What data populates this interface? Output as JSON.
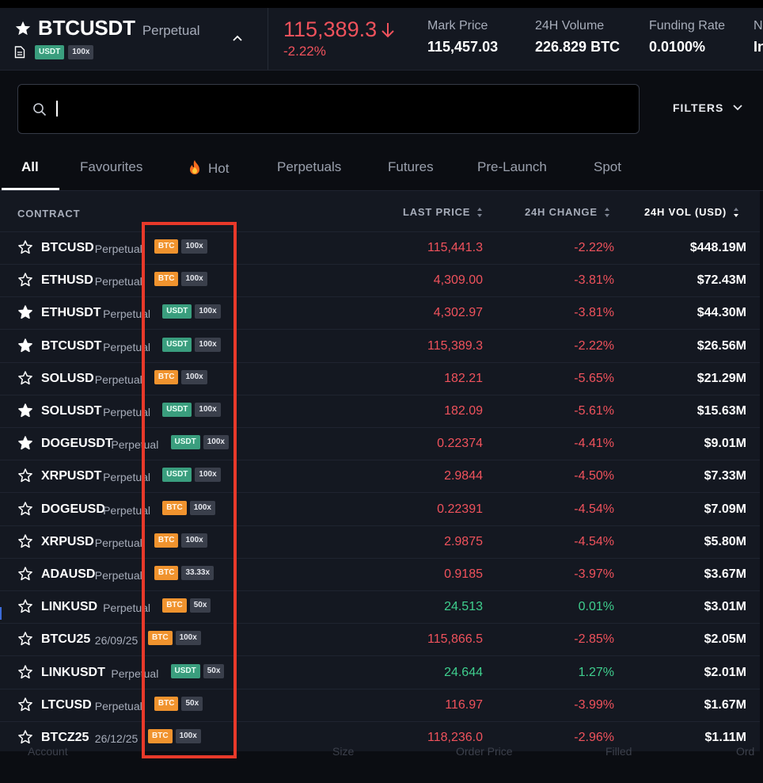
{
  "header": {
    "symbol": "BTCUSDT",
    "type": "Perpetual",
    "margin_tag": "USDT",
    "leverage_tag": "100x",
    "last_price": "115,389.3",
    "change": "-2.22%",
    "stats": [
      {
        "label": "Mark Price",
        "value": "115,457.03"
      },
      {
        "label": "24H Volume",
        "value": "226.829 BTC"
      },
      {
        "label": "Funding Rate",
        "value": "0.0100%"
      },
      {
        "label": "N",
        "value": "In"
      }
    ]
  },
  "search": {
    "placeholder": "",
    "value": ""
  },
  "filters_label": "FILTERS",
  "tabs": [
    "All",
    "Favourites",
    "Hot",
    "Perpetuals",
    "Futures",
    "Pre-Launch",
    "Spot"
  ],
  "table": {
    "headers": {
      "contract": "CONTRACT",
      "last_price": "LAST PRICE",
      "change": "24H CHANGE",
      "volume": "24H VOL (USD)"
    },
    "rows": [
      {
        "name": "BTCUSD",
        "type": "Perpetual",
        "margin": "BTC",
        "lev": "100x",
        "price": "115,441.3",
        "change": "-2.22%",
        "vol": "$448.19M"
      },
      {
        "name": "ETHUSD",
        "type": "Perpetual",
        "margin": "BTC",
        "lev": "100x",
        "price": "4,309.00",
        "change": "-3.81%",
        "vol": "$72.43M"
      },
      {
        "name": "ETHUSDT",
        "type": "Perpetual",
        "margin": "USDT",
        "lev": "100x",
        "price": "4,302.97",
        "change": "-3.81%",
        "vol": "$44.30M"
      },
      {
        "name": "BTCUSDT",
        "type": "Perpetual",
        "margin": "USDT",
        "lev": "100x",
        "price": "115,389.3",
        "change": "-2.22%",
        "vol": "$26.56M"
      },
      {
        "name": "SOLUSD",
        "type": "Perpetual",
        "margin": "BTC",
        "lev": "100x",
        "price": "182.21",
        "change": "-5.65%",
        "vol": "$21.29M"
      },
      {
        "name": "SOLUSDT",
        "type": "Perpetual",
        "margin": "USDT",
        "lev": "100x",
        "price": "182.09",
        "change": "-5.61%",
        "vol": "$15.63M"
      },
      {
        "name": "DOGEUSDT",
        "type": "Perpetual",
        "margin": "USDT",
        "lev": "100x",
        "price": "0.22374",
        "change": "-4.41%",
        "vol": "$9.01M"
      },
      {
        "name": "XRPUSDT",
        "type": "Perpetual",
        "margin": "USDT",
        "lev": "100x",
        "price": "2.9844",
        "change": "-4.50%",
        "vol": "$7.33M"
      },
      {
        "name": "DOGEUSD",
        "type": "Perpetual",
        "margin": "BTC",
        "lev": "100x",
        "price": "0.22391",
        "change": "-4.54%",
        "vol": "$7.09M"
      },
      {
        "name": "XRPUSD",
        "type": "Perpetual",
        "margin": "BTC",
        "lev": "100x",
        "price": "2.9875",
        "change": "-4.54%",
        "vol": "$5.80M"
      },
      {
        "name": "ADAUSD",
        "type": "Perpetual",
        "margin": "BTC",
        "lev": "33.33x",
        "price": "0.9185",
        "change": "-3.97%",
        "vol": "$3.67M"
      },
      {
        "name": "LINKUSD",
        "type": "Perpetual",
        "margin": "BTC",
        "lev": "50x",
        "price": "24.513",
        "change": "0.01%",
        "vol": "$3.01M"
      },
      {
        "name": "BTCU25",
        "type": "26/09/25",
        "margin": "BTC",
        "lev": "100x",
        "price": "115,866.5",
        "change": "-2.85%",
        "vol": "$2.05M"
      },
      {
        "name": "LINKUSDT",
        "type": "Perpetual",
        "margin": "USDT",
        "lev": "50x",
        "price": "24.644",
        "change": "1.27%",
        "vol": "$2.01M"
      },
      {
        "name": "LTCUSD",
        "type": "Perpetual",
        "margin": "BTC",
        "lev": "50x",
        "price": "116.97",
        "change": "-3.99%",
        "vol": "$1.67M"
      },
      {
        "name": "BTCZ25",
        "type": "26/12/25",
        "margin": "BTC",
        "lev": "100x",
        "price": "118,236.0",
        "change": "-2.96%",
        "vol": "$1.11M"
      }
    ]
  },
  "favourites": [
    "ETHUSDT",
    "BTCUSDT",
    "SOLUSDT",
    "DOGEUSDT"
  ],
  "background_labels": [
    "Account",
    "Size",
    "Order Price",
    "Filled",
    "Ord"
  ],
  "colors": {
    "negative": "#f0525c",
    "positive": "#3fcf8e",
    "usdt_tag": "#3a9e7e",
    "btc_tag": "#f0932e",
    "highlight_box": "#e8392a"
  }
}
